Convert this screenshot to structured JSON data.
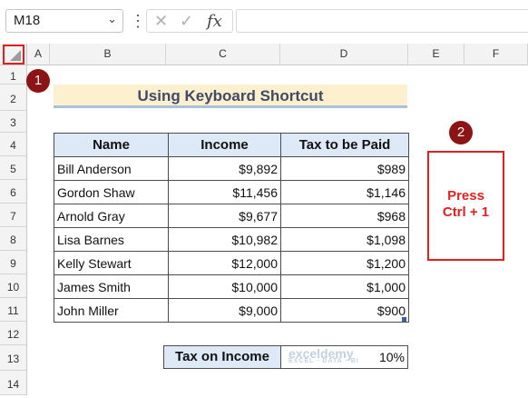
{
  "formula_bar": {
    "name_box": "M18",
    "dropdown_glyph": "⌄",
    "separator_glyph": "⋮",
    "cancel_glyph": "✕",
    "enter_glyph": "✓",
    "fx_glyph": "fx",
    "formula_value": ""
  },
  "columns": [
    "A",
    "B",
    "C",
    "D",
    "E",
    "F"
  ],
  "rows": [
    "1",
    "2",
    "3",
    "4",
    "5",
    "6",
    "7",
    "8",
    "9",
    "10",
    "11",
    "12",
    "13",
    "14"
  ],
  "badges": {
    "one": "1",
    "two": "2"
  },
  "sheet": {
    "title": "Using Keyboard Shortcut",
    "headers": [
      "Name",
      "Income",
      "Tax to be Paid"
    ],
    "records": [
      [
        "Bill Anderson",
        "$9,892",
        "$989"
      ],
      [
        "Gordon Shaw",
        "$11,456",
        "$1,146"
      ],
      [
        "Arnold Gray",
        "$9,677",
        "$968"
      ],
      [
        "Lisa Barnes",
        "$10,982",
        "$1,098"
      ],
      [
        "Kelly Stewart",
        "$12,000",
        "$1,200"
      ],
      [
        "James Smith",
        "$10,000",
        "$1,000"
      ],
      [
        "John Miller",
        "$9,000",
        "$900"
      ]
    ],
    "tax_label": "Tax on Income",
    "tax_value": "10%"
  },
  "callout": {
    "line1": "Press",
    "line2": "Ctrl + 1"
  },
  "watermark": {
    "name": "exceldemy",
    "tagline": "EXCEL · DATA · BI"
  },
  "colors": {
    "highlight_red": "#e22020",
    "badge": "#8d1414",
    "header_fill": "#dde9f6",
    "title_fill": "#fdf0cf"
  }
}
